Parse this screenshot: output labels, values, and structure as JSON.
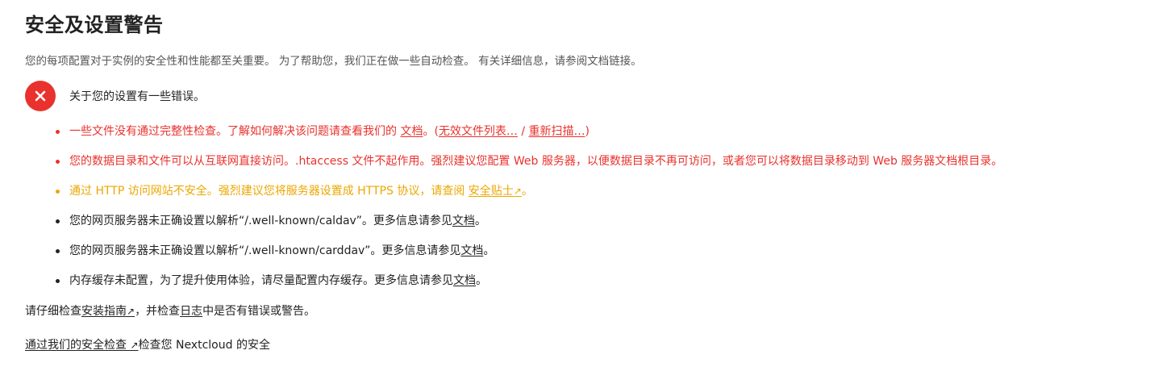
{
  "title": "安全及设置警告",
  "intro": "您的每项配置对于实例的安全性和性能都至关重要。 为了帮助您，我们正在做一些自动检查。 有关详细信息，请参阅文档链接。",
  "error_header": "关于您的设置有一些错误。",
  "colors": {
    "error": "#e9322d",
    "warning": "#eca700",
    "info": "#222222"
  },
  "issues": [
    {
      "level": "error",
      "text": "一些文件没有通过完整性检查。了解如何解决该问题请查看我们的 ",
      "link1": "文档",
      "mid": "。(",
      "link2": "无效文件列表…",
      "sep": " / ",
      "link3": "重新扫描…",
      "end": ")"
    },
    {
      "level": "error",
      "text": "您的数据目录和文件可以从互联网直接访问。.htaccess 文件不起作用。强烈建议您配置 Web 服务器，以便数据目录不再可访问，或者您可以将数据目录移动到 Web 服务器文档根目录。"
    },
    {
      "level": "warning",
      "text": "通过 HTTP 访问网站不安全。强烈建议您将服务器设置成 HTTPS 协议，请查阅 ",
      "link": "安全贴士",
      "link_icon": "↗",
      "end": "。"
    },
    {
      "level": "info",
      "text": "您的网页服务器未正确设置以解析“/.well-known/caldav”。更多信息请参见",
      "link": "文档",
      "end": "。"
    },
    {
      "level": "info",
      "text": "您的网页服务器未正确设置以解析“/.well-known/carddav”。更多信息请参见",
      "link": "文档",
      "end": "。"
    },
    {
      "level": "info",
      "text": "内存缓存未配置，为了提升使用体验，请尽量配置内存缓存。更多信息请参见",
      "link": "文档",
      "end": "。"
    }
  ],
  "footer1": {
    "pre": "请仔细检查",
    "link1": "安装指南",
    "link1_icon": "↗",
    "mid": "，并检查",
    "link2": "日志",
    "end": "中是否有错误或警告。"
  },
  "footer2": {
    "link": "通过我们的安全检查 ",
    "link_icon": "↗",
    "end": "检查您 Nextcloud 的安全"
  }
}
